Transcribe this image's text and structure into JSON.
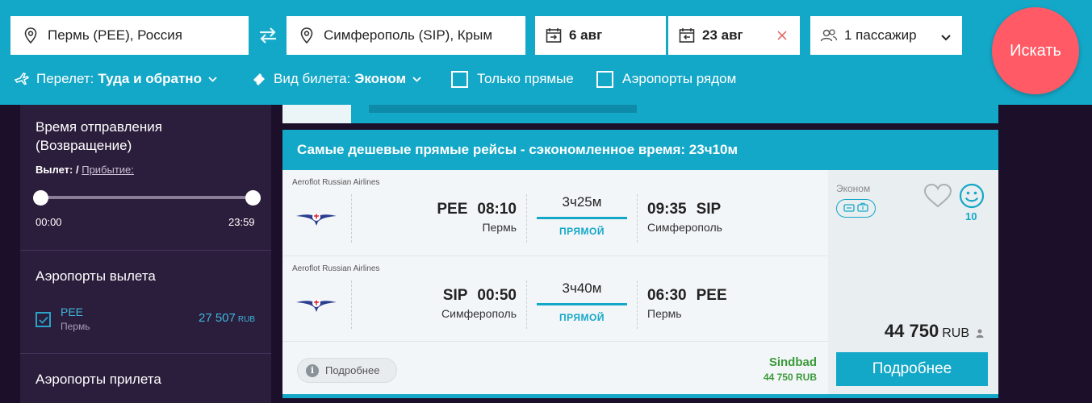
{
  "search": {
    "origin": "Пермь (PEE), Россия",
    "destination": "Симферополь (SIP), Крым",
    "depart_date": "6 авг",
    "return_date": "23 авг",
    "passengers": "1 пассажир",
    "search_label": "Искать"
  },
  "options": {
    "flight_label": "Перелет:",
    "flight_value": "Туда и обратно",
    "ticket_label": "Вид билета:",
    "ticket_value": "Эконом",
    "direct_only": "Только прямые",
    "nearby_airports": "Аэропорты рядом"
  },
  "sidebar": {
    "time_title": "Время отправления (Возвращение)",
    "departure_label": "Вылет:",
    "separator": "/",
    "arrival_label": "Прибытие:",
    "time_min": "00:00",
    "time_max": "23:59",
    "departure_airports_title": "Аэропорты вылета",
    "airport": {
      "code": "PEE",
      "city": "Пермь",
      "price": "27 507",
      "currency": "RUB"
    },
    "arrival_airports_title": "Аэропорты прилета"
  },
  "card": {
    "title": "Самые дешевые прямые рейсы - сэкономленное время: 23ч10м",
    "legs": [
      {
        "airline": "Aeroflot Russian Airlines",
        "dep_code": "PEE",
        "dep_time": "08:10",
        "dep_city": "Пермь",
        "duration": "3ч25м",
        "type": "ПРЯМОЙ",
        "arr_time": "09:35",
        "arr_code": "SIP",
        "arr_city": "Симферополь"
      },
      {
        "airline": "Aeroflot Russian Airlines",
        "dep_code": "SIP",
        "dep_time": "00:50",
        "dep_city": "Симферополь",
        "duration": "3ч40м",
        "type": "ПРЯМОЙ",
        "arr_time": "06:30",
        "arr_code": "PEE",
        "arr_city": "Пермь"
      }
    ],
    "more_label": "Подробнее",
    "agency_name": "Sindbad",
    "agency_price": "44 750 RUB",
    "class": "Эконом",
    "rating": "10",
    "price": "44 750",
    "currency": "RUB",
    "detail_button": "Подробнее"
  },
  "colors": {
    "primary": "#14a8c8",
    "accent": "#ff5a66",
    "sidebar": "#2b1d3c",
    "agency": "#3a9a3a"
  }
}
